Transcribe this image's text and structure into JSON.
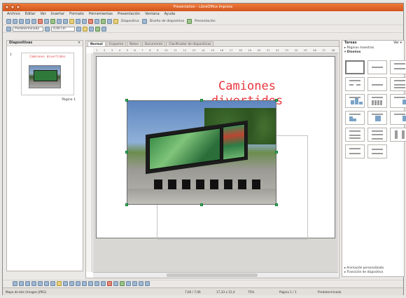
{
  "window": {
    "title": "Presentation - LibreOffice Impress"
  },
  "menu": [
    "Archivo",
    "Editar",
    "Ver",
    "Insertar",
    "Formato",
    "Herramientas",
    "Presentación",
    "Ventana",
    "Ayuda"
  ],
  "toolbar": {
    "slide_label": "Diapositiva",
    "layout_label": "Diseño de diapositiva",
    "presentation_label": "Presentación",
    "style_combo": "Predeterminado",
    "size_combo": "0,00 cm"
  },
  "slides_panel": {
    "title": "Diapositivas",
    "close": "×",
    "slide_number": "1",
    "slide_label": "Página 1",
    "thumb_title": "Camiones divertidos"
  },
  "tabs": [
    "Normal",
    "Esquema",
    "Notas",
    "Documento",
    "Clasificador de diapositivas"
  ],
  "ruler": [
    "1",
    "2",
    "3",
    "4",
    "5",
    "6",
    "7",
    "8",
    "9",
    "10",
    "11",
    "12",
    "13",
    "14",
    "15",
    "16",
    "17",
    "18",
    "19",
    "20",
    "21",
    "22",
    "23",
    "24",
    "25",
    "26",
    "27",
    "28"
  ],
  "slide": {
    "title_line1": "Camiones",
    "title_line2": "divertidos"
  },
  "tasks_panel": {
    "title": "Tareas",
    "view": "Ver ▾",
    "section_master": "▸ Páginas maestras",
    "section_layouts": "▾ Diseños",
    "section_animation": "▸ Animación personalizada",
    "section_transition": "▸ Transición de diapositiva"
  },
  "status": {
    "object": "Mapa de bits (Imagen JPEG)",
    "position": "7,60 / 7,06",
    "size": "17,33 x 12,4",
    "zoom": "75%",
    "page": "Página 1 / 1",
    "master": "Predeterminado"
  }
}
